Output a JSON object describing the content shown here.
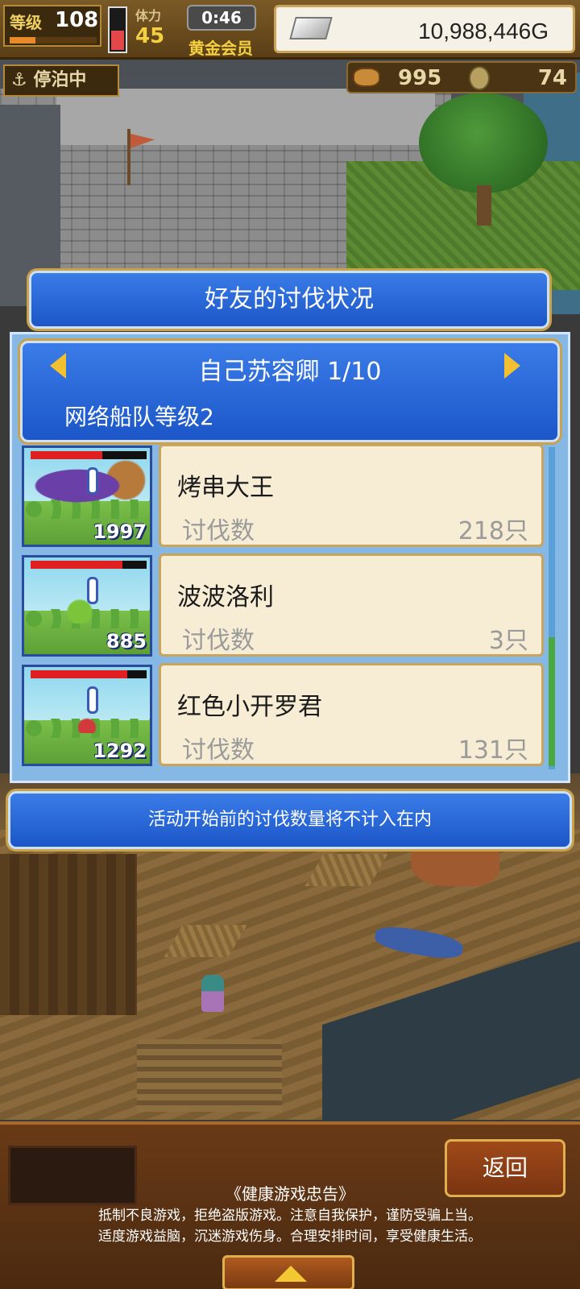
{
  "hud": {
    "level_label": "等级",
    "level_value": "108",
    "level_progress": 0.3,
    "stamina_fill": 0.45,
    "daily_label": "体力",
    "daily_value": "45",
    "timer": "0:46",
    "membership": "黄金会员",
    "money": "10,988,446G",
    "status": "停泊中",
    "food": "995",
    "coins": "74",
    "icons": {
      "level": "level-badge-icon",
      "money": "silver-bar-icon",
      "anchor": "anchor-icon",
      "food": "meat-icon",
      "coin": "coin-icon"
    }
  },
  "modal": {
    "title": "好友的讨伐状况",
    "player_name": "自己苏容卿 1/10",
    "fleet_level": "网络船队等级2",
    "rows": [
      {
        "name": "烤串大王",
        "label": "讨伐数",
        "value": "218只",
        "level": "1997",
        "hp": 0.62
      },
      {
        "name": "波波洛利",
        "label": "讨伐数",
        "value": "3只",
        "level": "885",
        "hp": 0.79
      },
      {
        "name": "红色小开罗君",
        "label": "讨伐数",
        "value": "131只",
        "level": "1292",
        "hp": 0.83
      }
    ],
    "notice": "活动开始前的讨伐数量将不计入在内"
  },
  "bottom": {
    "back_label": "返回",
    "health_title": "《健康游戏忠告》",
    "health_line1": "抵制不良游戏，拒绝盗版游戏。注意自我保护，谨防受骗上当。",
    "health_line2": "适度游戏益脑，沉迷游戏伤身。合理安排时间，享受健康生活。"
  },
  "colors": {
    "accent_blue": "#1c56c8",
    "card_bg": "#f7edd4",
    "gold_border": "#c9a24a",
    "arrow_gold": "#f2c030"
  }
}
